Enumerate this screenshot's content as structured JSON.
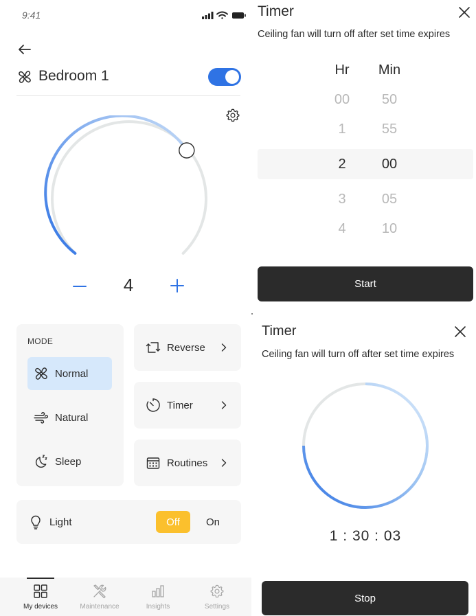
{
  "status_bar": {
    "time": "9:41"
  },
  "device": {
    "name": "Bedroom 1",
    "power_on": true
  },
  "speed": {
    "value": "4",
    "level_fraction": 0.8
  },
  "mode": {
    "label": "MODE",
    "items": [
      {
        "label": "Normal",
        "icon": "fan-icon",
        "active": true
      },
      {
        "label": "Natural",
        "icon": "wind-icon",
        "active": false
      },
      {
        "label": "Sleep",
        "icon": "moon-icon",
        "active": false
      }
    ]
  },
  "actions": [
    {
      "label": "Reverse",
      "icon": "reverse-icon"
    },
    {
      "label": "Timer",
      "icon": "timer-icon"
    },
    {
      "label": "Routines",
      "icon": "calendar-icon"
    }
  ],
  "light": {
    "label": "Light",
    "off_label": "Off",
    "on_label": "On",
    "state": "Off"
  },
  "tabs": [
    {
      "label": "My devices",
      "icon": "grid-icon",
      "active": true
    },
    {
      "label": "Maintenance",
      "icon": "tools-icon",
      "active": false
    },
    {
      "label": "Insights",
      "icon": "bar-chart-icon",
      "active": false
    },
    {
      "label": "Settings",
      "icon": "gear-icon",
      "active": false
    }
  ],
  "timer_picker": {
    "title": "Timer",
    "subtitle": "Ceiling fan will turn off after set time expires",
    "hr_label": "Hr",
    "min_label": "Min",
    "hours": [
      "00",
      "1",
      "2",
      "3",
      "4"
    ],
    "minutes": [
      "50",
      "55",
      "00",
      "05",
      "10"
    ],
    "selected_hour": "2",
    "selected_minute": "00",
    "start_label": "Start"
  },
  "timer_running": {
    "title": "Timer",
    "subtitle": "Ceiling fan will turn off after set time expires",
    "remaining": "1 : 30 : 03",
    "stop_label": "Stop"
  },
  "colors": {
    "accent": "#2f73e4",
    "accent_light": "#d6e8fb",
    "light_off": "#fbc02d",
    "dark_button": "#2b2b2b",
    "card": "#f6f6f6"
  }
}
